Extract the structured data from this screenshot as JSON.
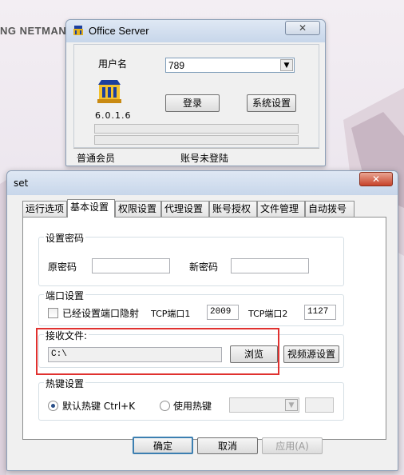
{
  "background": {
    "brand_text": "NG NETMAN"
  },
  "login_window": {
    "title": "Office Server",
    "close_glyph": "✕",
    "username_label": "用户名",
    "username_value": "789",
    "version": "6.0.1.6",
    "login_button": "登录",
    "system_settings_button": "系统设置",
    "status_left": "普通会员",
    "status_right": "账号未登陆"
  },
  "set_dialog": {
    "title": "set",
    "close_glyph": "✕",
    "tabs": [
      {
        "label": "运行选项",
        "active": false
      },
      {
        "label": "基本设置",
        "active": true
      },
      {
        "label": "权限设置",
        "active": false
      },
      {
        "label": "代理设置",
        "active": false
      },
      {
        "label": "账号授权",
        "active": false
      },
      {
        "label": "文件管理",
        "active": false
      },
      {
        "label": "自动拨号",
        "active": false
      }
    ],
    "password_group": {
      "title": "设置密码",
      "old_label": "原密码",
      "old_value": "",
      "new_label": "新密码",
      "new_value": ""
    },
    "port_group": {
      "title": "端口设置",
      "mapped_label": "已经设置端口隐射",
      "mapped_checked": false,
      "tcp1_label": "TCP端口1",
      "tcp1_value": "2009",
      "tcp2_label": "TCP端口2",
      "tcp2_value": "1127"
    },
    "receive_group": {
      "title": "接收文件:",
      "path_value": "C:\\",
      "browse_button": "浏览",
      "video_source_button": "视频源设置"
    },
    "hotkey_group": {
      "title": "热键设置",
      "default_label": "默认热键 Ctrl+K",
      "default_selected": true,
      "custom_label": "使用热键",
      "custom_selected": false,
      "hotkey_combo_value": "",
      "hotkey_input_value": ""
    },
    "ok_button": "确定",
    "cancel_button": "取消",
    "apply_button": "应用(A)"
  },
  "colors": {
    "highlight": "#e0312f",
    "title_bar": "#c7d6ea"
  }
}
